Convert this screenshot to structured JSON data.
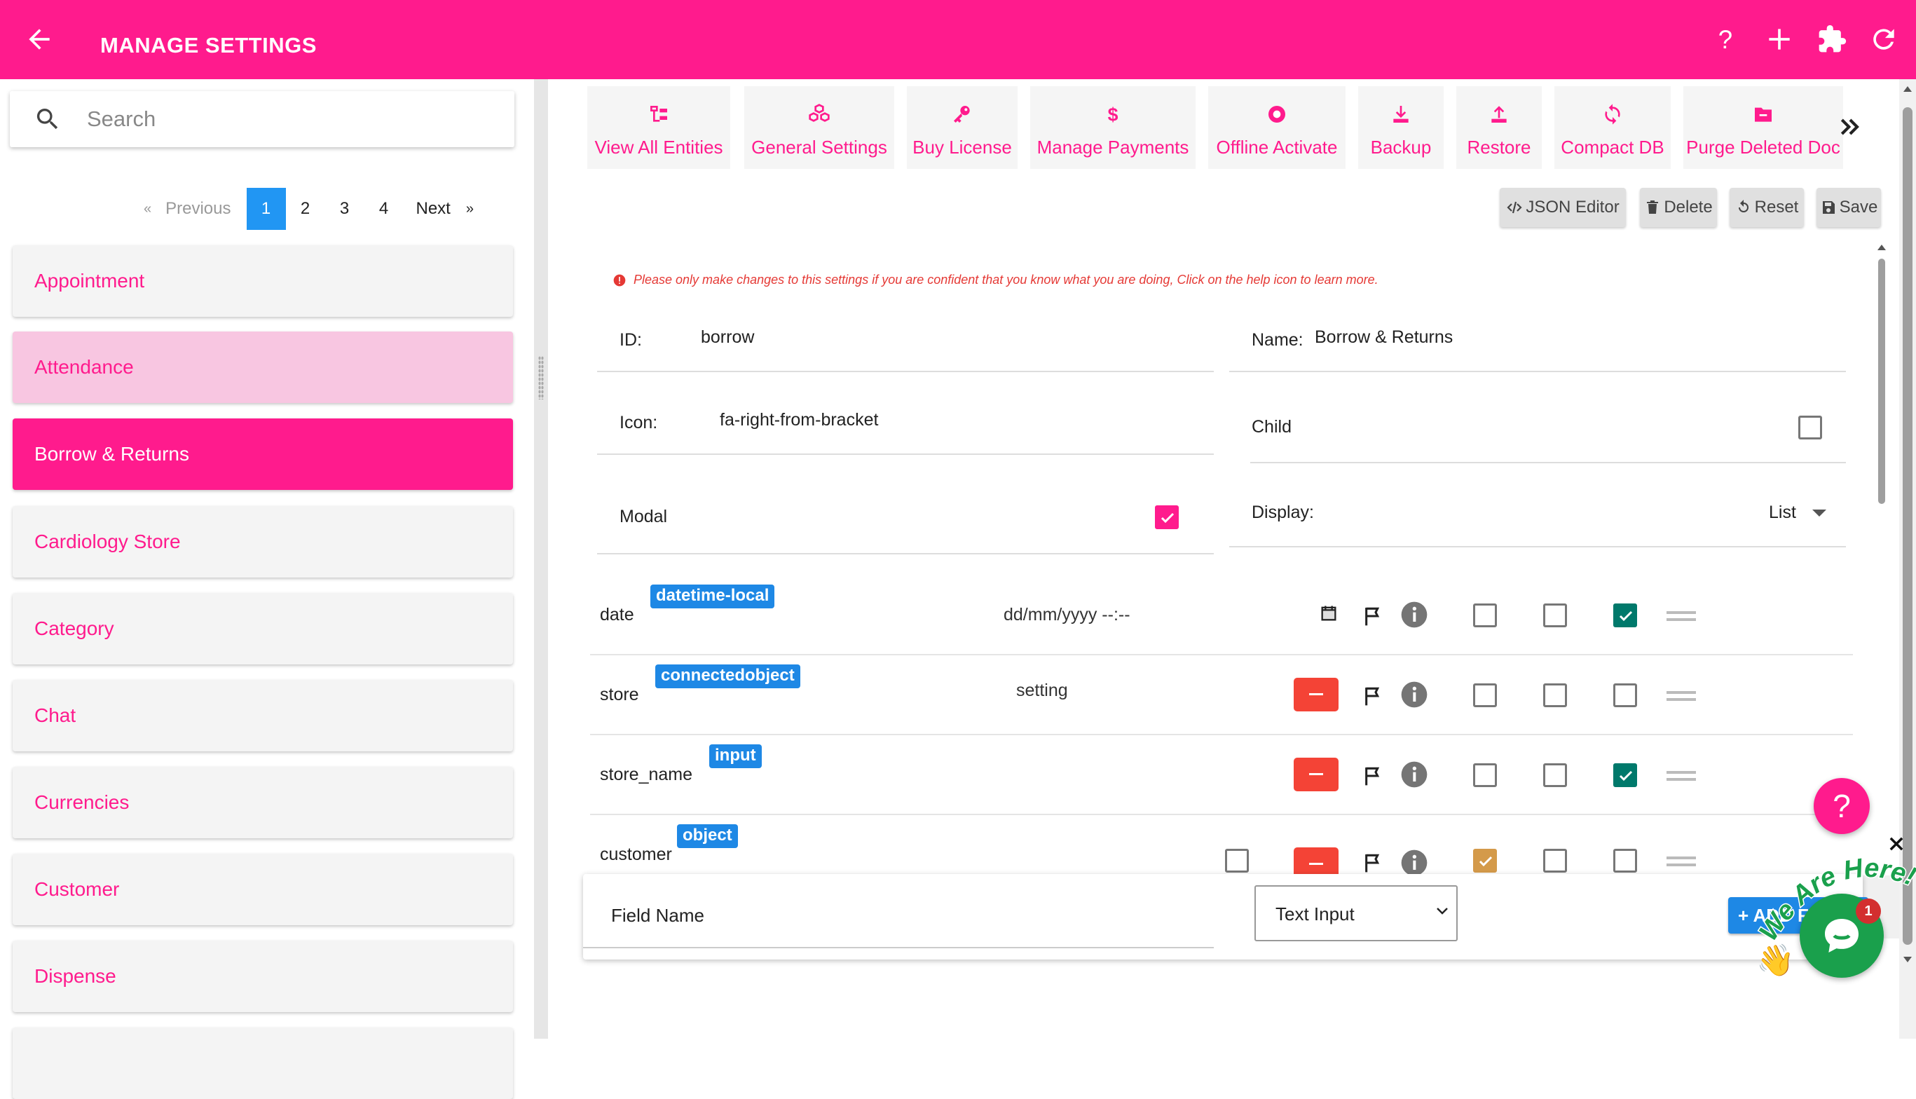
{
  "header": {
    "title": "MANAGE SETTINGS",
    "icons": [
      "back-arrow-icon",
      "help-icon",
      "plus-icon",
      "puzzle-icon",
      "refresh-icon"
    ],
    "color": "#ff1b8d"
  },
  "sidebar": {
    "search_placeholder": "Search",
    "pagination": {
      "prev_arrow": "«",
      "previous": "Previous",
      "pages": [
        "1",
        "2",
        "3",
        "4"
      ],
      "active_page": "1",
      "next": "Next",
      "next_arrow": "»"
    },
    "items": [
      {
        "label": "Appointment",
        "state": "normal"
      },
      {
        "label": "Attendance",
        "state": "hover"
      },
      {
        "label": "Borrow & Returns",
        "state": "active"
      },
      {
        "label": "Cardiology Store",
        "state": "normal"
      },
      {
        "label": "Category",
        "state": "normal"
      },
      {
        "label": "Chat",
        "state": "normal"
      },
      {
        "label": "Currencies",
        "state": "normal"
      },
      {
        "label": "Customer",
        "state": "normal"
      },
      {
        "label": "Dispense",
        "state": "normal"
      }
    ]
  },
  "toolbar": {
    "tabs": [
      {
        "label": "View All Entities",
        "icon": "sitemap-icon"
      },
      {
        "label": "General Settings",
        "icon": "cubes-icon"
      },
      {
        "label": "Buy License",
        "icon": "key-icon"
      },
      {
        "label": "Manage Payments",
        "icon": "dollar-icon"
      },
      {
        "label": "Offline Activate",
        "icon": "record-icon"
      },
      {
        "label": "Backup",
        "icon": "download-icon"
      },
      {
        "label": "Restore",
        "icon": "upload-icon"
      },
      {
        "label": "Compact DB",
        "icon": "sync-icon"
      },
      {
        "label": "Purge Deleted Doc",
        "icon": "folder-minus-icon"
      }
    ],
    "more_icon": "double-chevron-right-icon",
    "actions": {
      "json_editor": "JSON Editor",
      "delete": "Delete",
      "reset": "Reset",
      "save": "Save"
    }
  },
  "form": {
    "warning": "Please only make changes to this settings if you are confident that you know what you are doing, Click on the help icon to learn more.",
    "id_label": "ID:",
    "id_value": "borrow",
    "name_label": "Name:",
    "name_value": "Borrow & Returns",
    "icon_label": "Icon:",
    "icon_value": "fa-right-from-bracket",
    "child_label": "Child",
    "child_checked": false,
    "modal_label": "Modal",
    "modal_checked": true,
    "display_label": "Display:",
    "display_value": "List"
  },
  "fields": [
    {
      "name": "date",
      "type": "datetime-local",
      "value": "dd/mm/yyyy --:--",
      "checks": [
        false,
        false,
        true
      ]
    },
    {
      "name": "store",
      "type": "connectedobject",
      "value": "setting",
      "checks": [
        false,
        false,
        false
      ]
    },
    {
      "name": "store_name",
      "type": "input",
      "value": "",
      "checks": [
        false,
        false,
        true
      ]
    },
    {
      "name": "customer",
      "type": "object",
      "value": "",
      "checks": [
        true,
        false,
        false
      ]
    }
  ],
  "add_field": {
    "placeholder": "Field Name",
    "type_selected": "Text Input",
    "add_label": "+ ADD FIELD"
  },
  "floating": {
    "help_label": "?",
    "chat_badge": "1",
    "chat_banner": "We Are Here!"
  }
}
